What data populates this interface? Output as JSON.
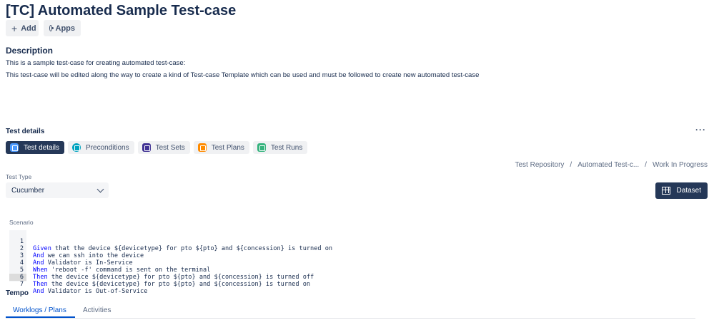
{
  "page": {
    "title": "[TC] Automated Sample Test-case"
  },
  "actions": {
    "add_label": "Add",
    "apps_label": "Apps"
  },
  "description": {
    "heading": "Description",
    "lines": [
      "This is a sample test-case for creating automated test-case:",
      "This test-case will be edited along the way to create a kind of Test-case Template which can be used and must be followed to create new automated test-case"
    ]
  },
  "test_details": {
    "heading": "Test details",
    "more_label": "···",
    "tabs": [
      {
        "label": "Test details",
        "icon": "test-details-icon",
        "active": true
      },
      {
        "label": "Preconditions",
        "icon": "preconditions-icon",
        "active": false
      },
      {
        "label": "Test Sets",
        "icon": "test-sets-icon",
        "active": false
      },
      {
        "label": "Test Plans",
        "icon": "test-plans-icon",
        "active": false
      },
      {
        "label": "Test Runs",
        "icon": "test-runs-icon",
        "active": false
      }
    ],
    "breadcrumb": [
      "Test Repository",
      "/",
      "Automated Test-c...",
      "/",
      "Work In Progress"
    ],
    "test_type_label": "Test Type",
    "test_type_value": "Cucumber",
    "dataset_label": "Dataset",
    "scenario_label": "Scenario",
    "scenario": [
      {
        "n": "1",
        "kw": "Given",
        "rest": " that the device ${devicetype} for pto ${pto} and ${concession} is turned on"
      },
      {
        "n": "2",
        "kw": "And",
        "rest": " we can ssh into the device"
      },
      {
        "n": "3",
        "kw": "And",
        "rest": " Validator is In-Service"
      },
      {
        "n": "4",
        "kw": "When",
        "rest": " 'reboot -f' command is sent on the terminal"
      },
      {
        "n": "5",
        "kw": "Then",
        "rest": " the device ${devicetype} for pto ${pto} and ${concession} is turned off"
      },
      {
        "n": "6",
        "kw": "Then",
        "rest": " the device ${devicetype} for pto ${pto} and ${concession} is turned on"
      },
      {
        "n": "7",
        "kw": "And",
        "rest": " Validator is Out-of-Service"
      }
    ]
  },
  "tempo": {
    "heading": "Tempo",
    "tabs": [
      {
        "label": "Worklogs / Plans",
        "active": true
      },
      {
        "label": "Activities",
        "active": false
      }
    ]
  },
  "colors": {
    "primary_dark": "#253858",
    "link_blue": "#0052cc",
    "keyword_blue": "#0000ff"
  }
}
